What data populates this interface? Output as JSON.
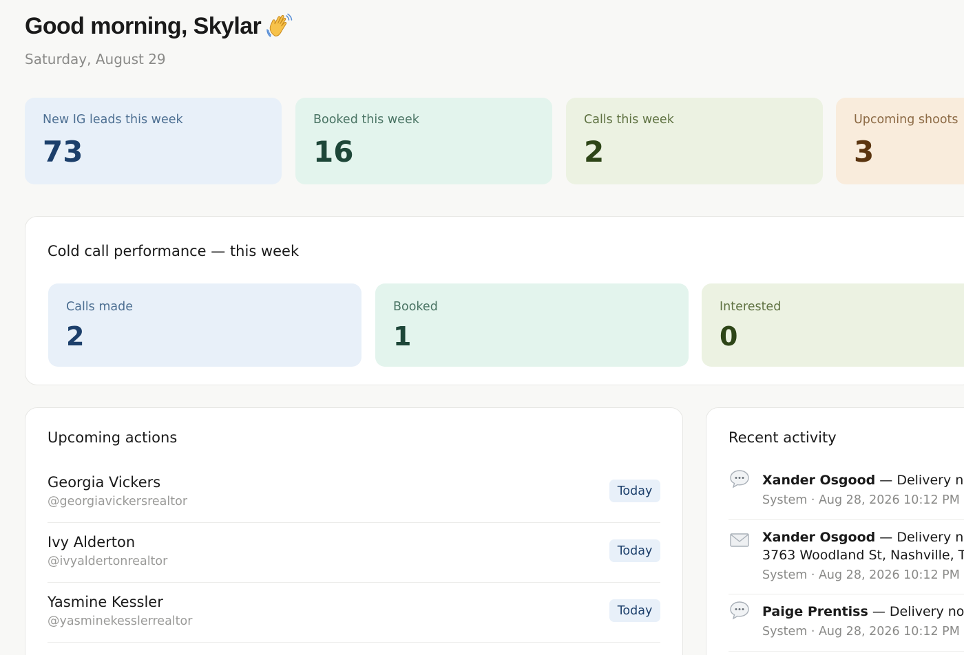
{
  "greeting": {
    "text": "Good morning, Skylar",
    "wave_icon": "waving-hand-icon",
    "date": "Saturday, August 29"
  },
  "stats": [
    {
      "label": "New IG leads this week",
      "value": "73",
      "color": "#e8f0f9"
    },
    {
      "label": "Booked this week",
      "value": "16",
      "color": "#e3f4ed"
    },
    {
      "label": "Calls this week",
      "value": "2",
      "color": "#ecf2e2"
    },
    {
      "label": "Upcoming shoots",
      "value": "3",
      "color": "#f9ecdc"
    }
  ],
  "cold_call": {
    "title": "Cold call performance — this week",
    "cards": [
      {
        "label": "Calls made",
        "value": "2"
      },
      {
        "label": "Booked",
        "value": "1"
      },
      {
        "label": "Interested",
        "value": "0"
      }
    ]
  },
  "upcoming_actions": {
    "title": "Upcoming actions",
    "items": [
      {
        "name": "Georgia Vickers",
        "handle": "@georgiavickersrealtor",
        "badge": "Today"
      },
      {
        "name": "Ivy Alderton",
        "handle": "@ivyaldertonrealtor",
        "badge": "Today"
      },
      {
        "name": "Yasmine Kessler",
        "handle": "@yasminekesslerrealtor",
        "badge": "Today"
      }
    ]
  },
  "recent_activity": {
    "title": "Recent activity",
    "items": [
      {
        "icon": "speech-bubble-icon",
        "actor": "Xander Osgood",
        "text": " — Delivery not",
        "extra": "",
        "meta": "System · Aug 28, 2026 10:12 PM"
      },
      {
        "icon": "envelope-icon",
        "actor": "Xander Osgood",
        "text": " — Delivery not",
        "extra": "3763 Woodland St, Nashville, T",
        "meta": "System · Aug 28, 2026 10:12 PM"
      },
      {
        "icon": "speech-bubble-icon",
        "actor": "Paige Prentiss",
        "text": " — Delivery notif",
        "extra": "",
        "meta": "System · Aug 28, 2026 10:12 PM"
      }
    ]
  }
}
